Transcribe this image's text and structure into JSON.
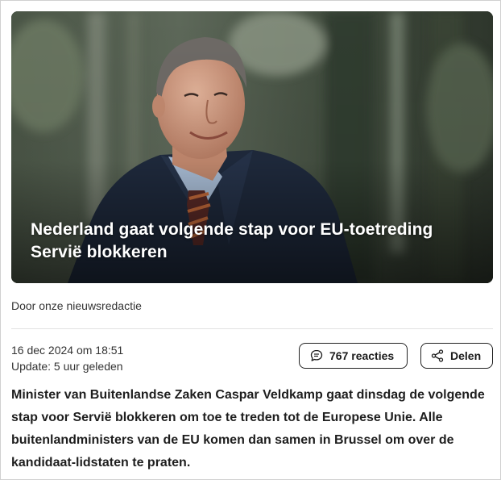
{
  "article": {
    "title": "Nederland gaat volgende stap voor EU-toetreding Servië blokkeren",
    "byline": "Door onze nieuwsredactie",
    "date": "16 dec 2024 om 18:51",
    "update": "Update: 5 uur geleden",
    "lead": "Minister van Buitenlandse Zaken Caspar Veldkamp gaat dinsdag de volgende stap voor Servië blokkeren om toe te treden tot de Europese Unie. Alle buitenlandministers van de EU komen dan samen in Brussel om over de kandidaat-lidstaten te praten."
  },
  "actions": {
    "comments_label": "767 reacties",
    "share_label": "Delen"
  },
  "icons": {
    "comments": "speech-bubble-icon",
    "share": "share-icon"
  },
  "colors": {
    "text": "#1a1a1a",
    "border": "#222222",
    "title_on_image": "#ffffff"
  }
}
